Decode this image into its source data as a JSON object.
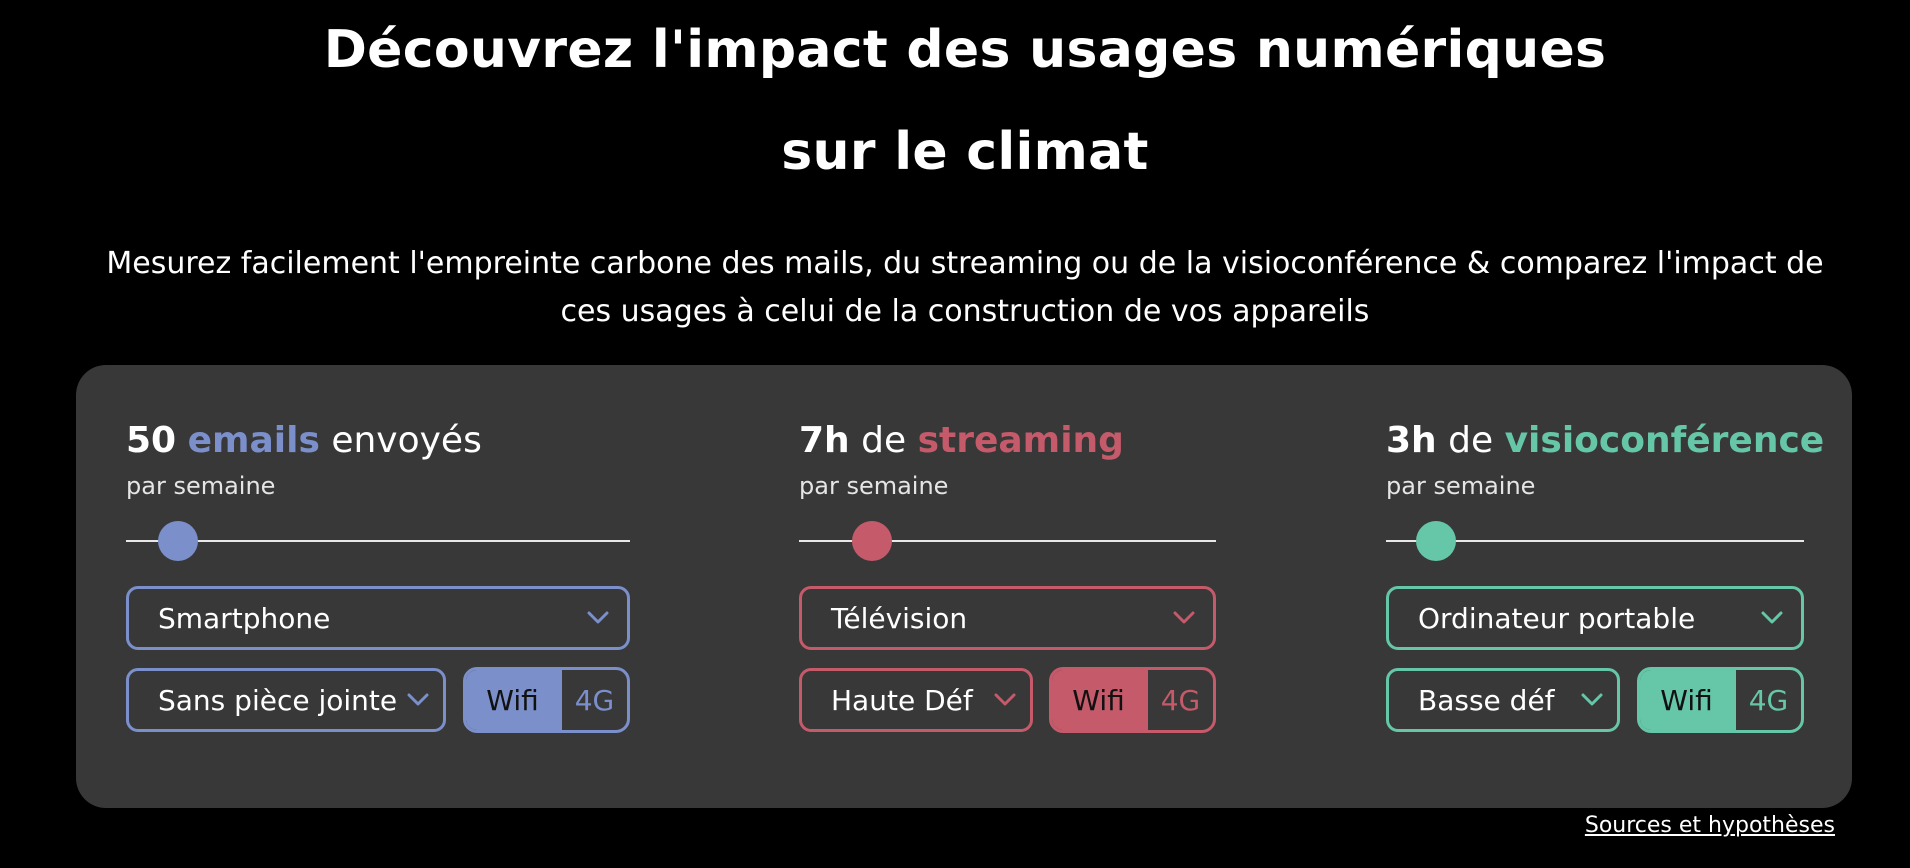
{
  "header": {
    "title_line1": "Découvrez l'impact des usages numériques",
    "title_line2": "sur le climat",
    "subtitle": "Mesurez facilement l'empreinte carbone des mails, du streaming ou de la visioconférence & comparez l'impact de ces usages à celui de la construction de vos appareils"
  },
  "cards": [
    {
      "id": "emails",
      "accent": "#7b8fcb",
      "amount": "50",
      "keyword": "emails",
      "suffix": " envoyés",
      "prefix": "",
      "period": "par semaine",
      "slider_fraction": 0.07,
      "device": {
        "value": "Smartphone",
        "icon": "chevron-down-icon"
      },
      "option": {
        "value": "Sans pièce jointe",
        "icon": "chevron-down-icon"
      },
      "network": {
        "options": [
          "Wifi",
          "4G"
        ],
        "selected": "Wifi"
      }
    },
    {
      "id": "streaming",
      "accent": "#c45a6a",
      "amount": "7h",
      "prefix": " de ",
      "keyword": "streaming",
      "suffix": "",
      "period": "par semaine",
      "slider_fraction": 0.14,
      "device": {
        "value": "Télévision",
        "icon": "chevron-down-icon"
      },
      "option": {
        "value": "Haute Déf",
        "icon": "chevron-down-icon"
      },
      "network": {
        "options": [
          "Wifi",
          "4G"
        ],
        "selected": "Wifi"
      }
    },
    {
      "id": "visio",
      "accent": "#66c6a8",
      "amount": "3h",
      "prefix": " de ",
      "keyword": "visioconférence",
      "suffix": "",
      "period": "par semaine",
      "slider_fraction": 0.08,
      "device": {
        "value": "Ordinateur portable",
        "icon": "chevron-down-icon"
      },
      "option": {
        "value": "Basse déf",
        "icon": "chevron-down-icon"
      },
      "network": {
        "options": [
          "Wifi",
          "4G"
        ],
        "selected": "Wifi"
      }
    }
  ],
  "footer": {
    "sources_link": "Sources et hypothèses"
  }
}
